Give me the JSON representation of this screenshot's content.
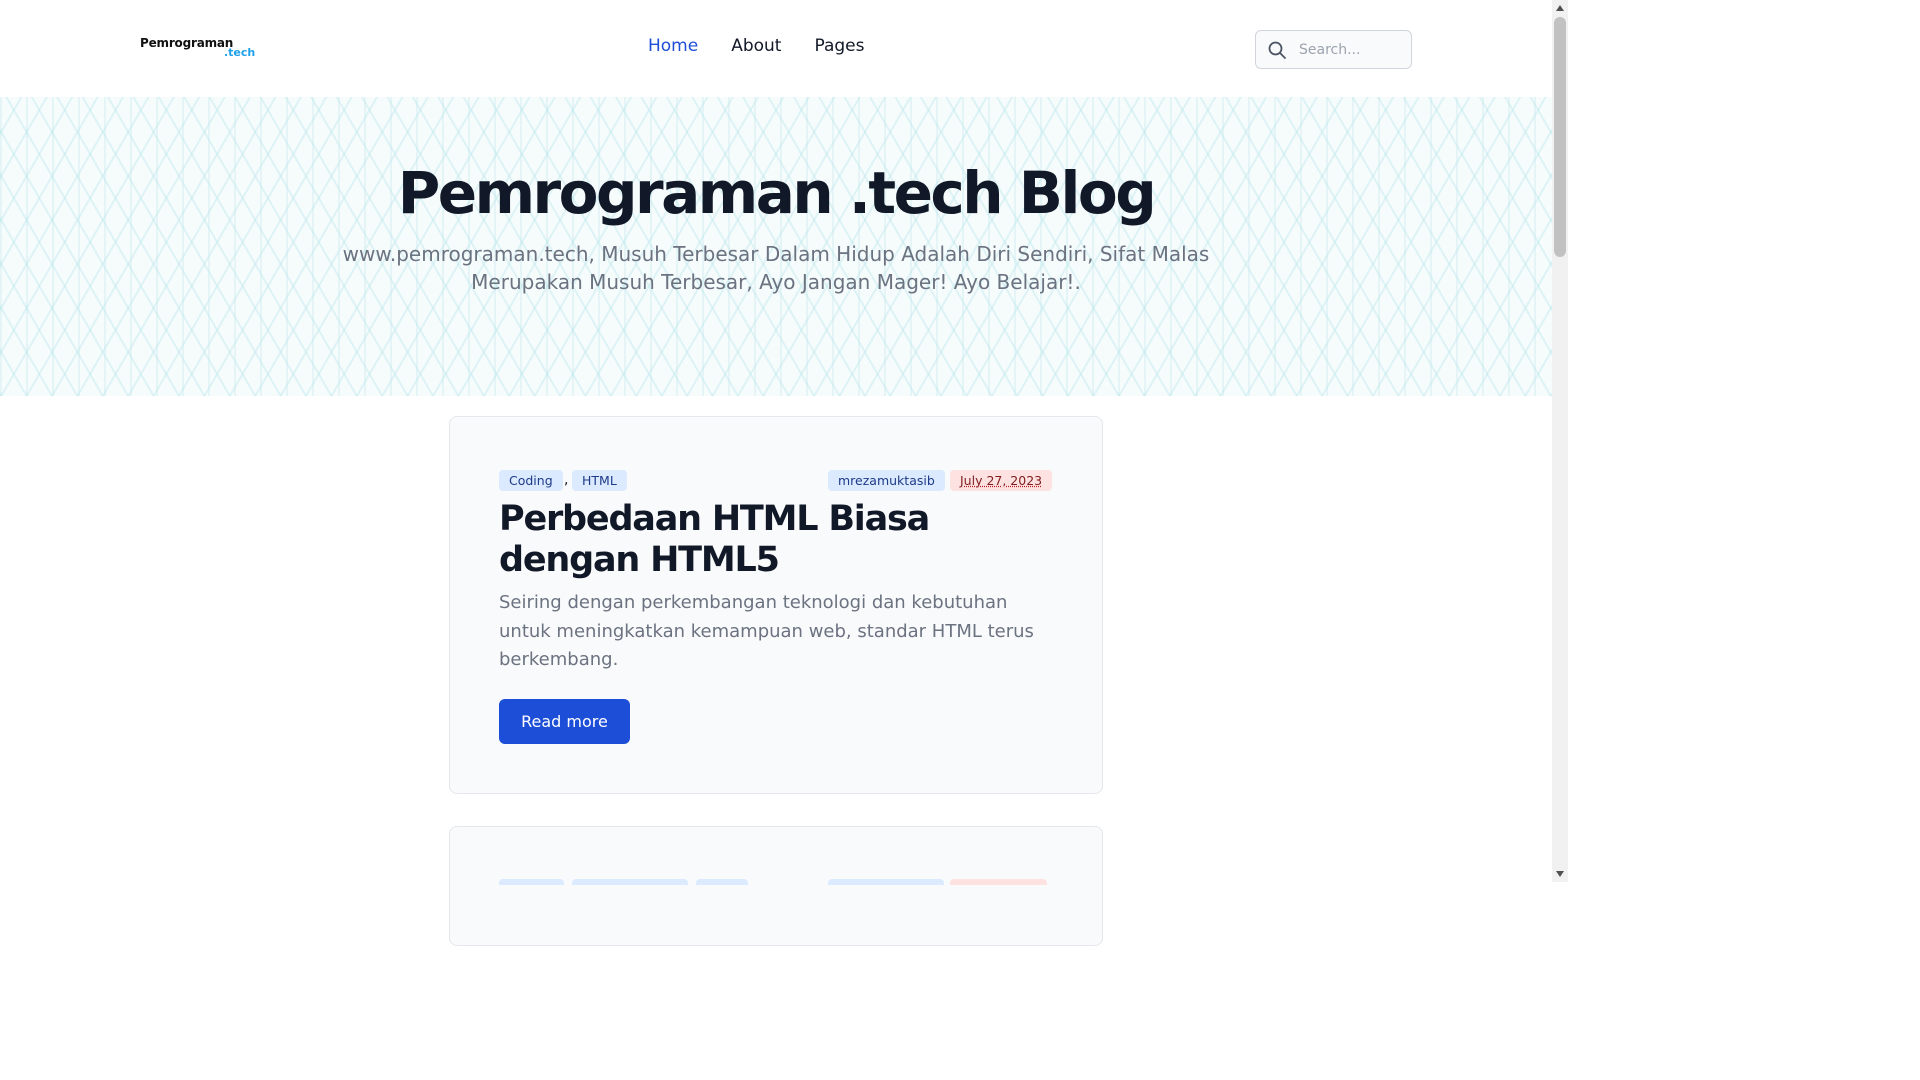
{
  "brand": {
    "name": "Pemrograman",
    "suffix": ".tech"
  },
  "nav": {
    "items": [
      {
        "label": "Home",
        "active": true
      },
      {
        "label": "About",
        "active": false
      },
      {
        "label": "Pages",
        "active": false
      }
    ]
  },
  "search": {
    "placeholder": "Search...",
    "value": "",
    "icon": "search-icon"
  },
  "hero": {
    "title": "Pemrograman .tech Blog",
    "subtitle": "www.pemrograman.tech, Musuh Terbesar Dalam Hidup Adalah Diri Sendiri, Sifat Malas Merupakan Musuh Terbesar, Ayo Jangan Mager! Ayo Belajar!."
  },
  "posts": [
    {
      "categories": [
        "Coding",
        "HTML"
      ],
      "category_separator": ",",
      "author": "mrezamuktasib",
      "date": "July 27, 2023",
      "title": "Perbedaan HTML Biasa dengan HTML5",
      "excerpt": "Seiring dengan perkembangan teknologi dan kebutuhan untuk meningkatkan kemampuan web, standar HTML terus berkembang.",
      "read_more_label": "Read more"
    }
  ],
  "colors": {
    "accent": "#1d4ed8",
    "brand_suffix": "#1ea0ea",
    "tag_bg": "#dbeafe",
    "date_bg": "#fee2e2"
  }
}
